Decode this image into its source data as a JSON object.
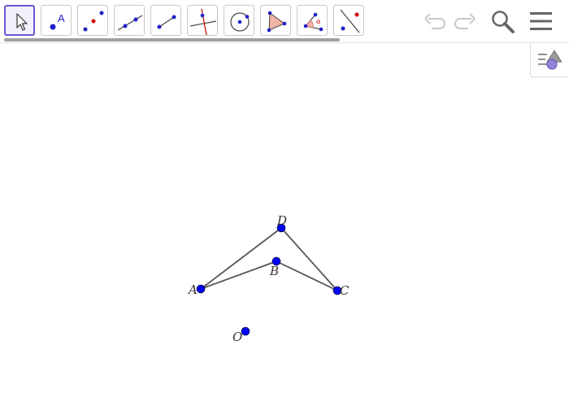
{
  "toolbar": {
    "tools": [
      {
        "id": "move",
        "icon": "move-arrow-icon",
        "selected": true
      },
      {
        "id": "point",
        "icon": "point-icon",
        "label": "A"
      },
      {
        "id": "point-on-object",
        "icon": "point-on-object-icon"
      },
      {
        "id": "line",
        "icon": "line-icon"
      },
      {
        "id": "segment",
        "icon": "segment-icon"
      },
      {
        "id": "perpendicular-line",
        "icon": "perpendicular-line-icon"
      },
      {
        "id": "circle",
        "icon": "circle-center-point-icon"
      },
      {
        "id": "polygon",
        "icon": "polygon-icon"
      },
      {
        "id": "angle",
        "icon": "angle-icon",
        "label": "α"
      },
      {
        "id": "reflect",
        "icon": "reflect-about-line-icon"
      }
    ],
    "actions": {
      "undo": "undo-icon",
      "redo": "redo-icon",
      "search": "search-icon",
      "menu": "menu-icon"
    }
  },
  "side_toggle": {
    "icon": "algebra-view-toggle-icon"
  },
  "colors": {
    "point": "#0000ff",
    "point_outline": "#000066",
    "segment": "#555555",
    "accent": "#6557d2",
    "icon_red": "#cc0000"
  },
  "construction": {
    "points": [
      {
        "name": "A"
      },
      {
        "name": "B"
      },
      {
        "name": "C"
      },
      {
        "name": "D"
      },
      {
        "name": "O"
      }
    ],
    "segments": [
      {
        "name": "AD"
      },
      {
        "name": "DC"
      },
      {
        "name": "AB"
      },
      {
        "name": "BC"
      }
    ]
  }
}
